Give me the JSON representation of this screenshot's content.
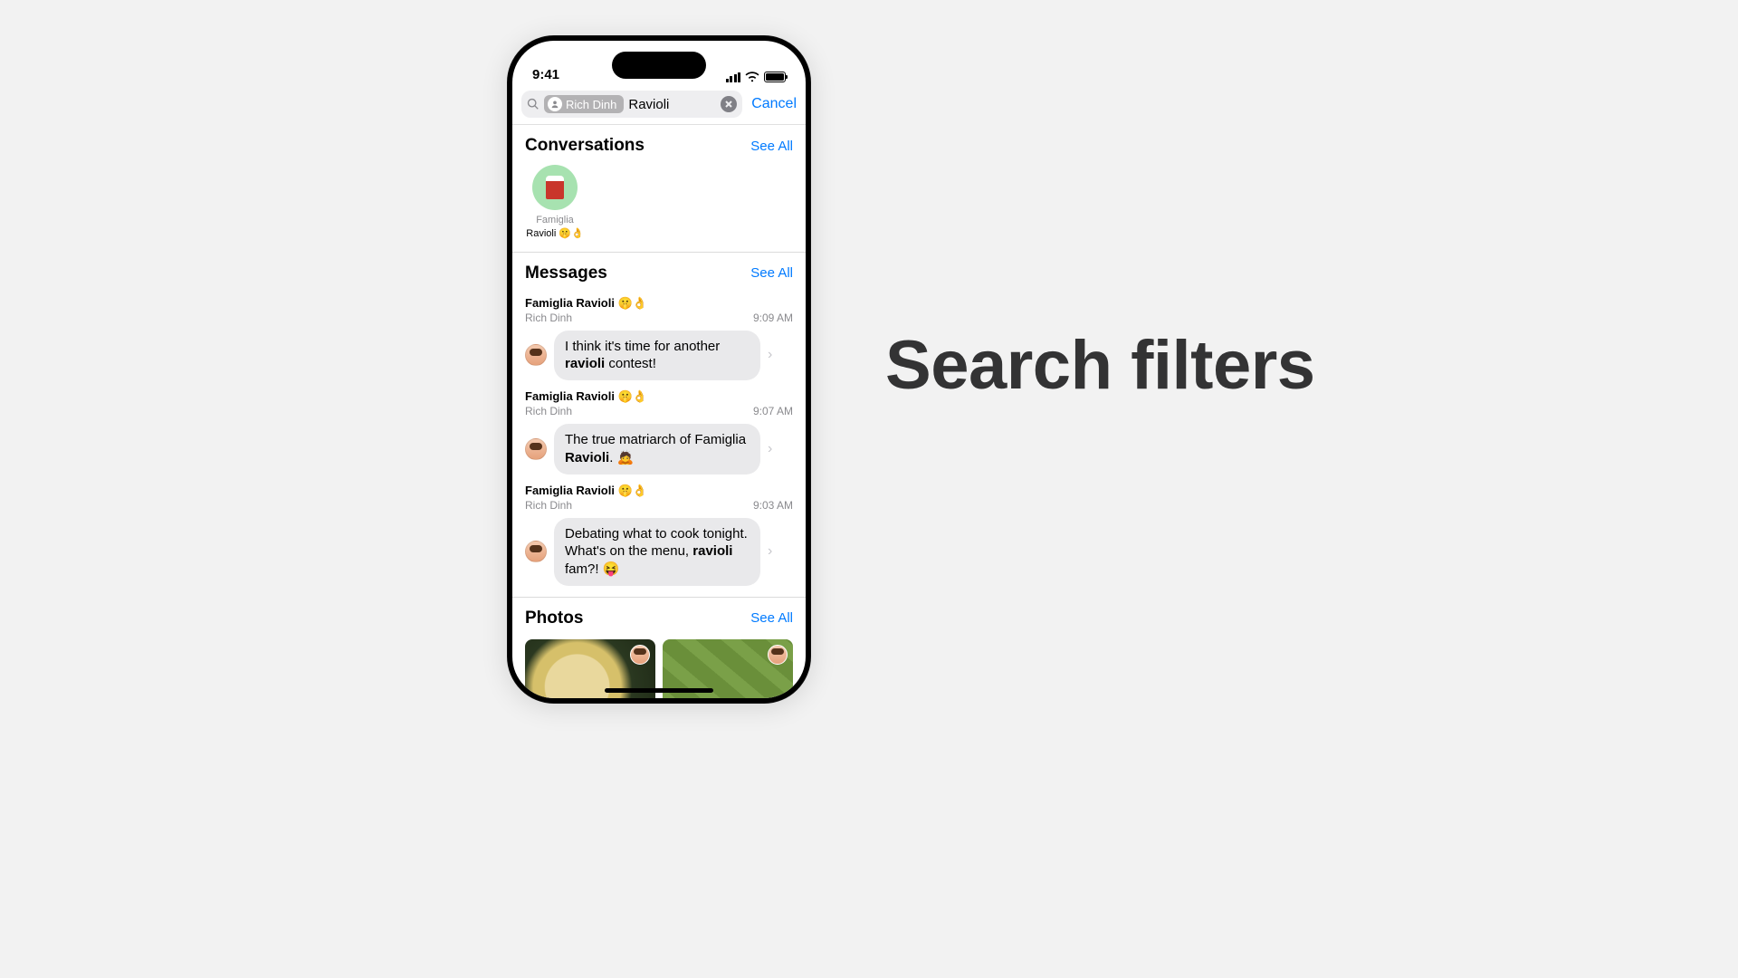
{
  "feature_title": "Search filters",
  "status": {
    "time": "9:41"
  },
  "search": {
    "token_name": "Rich Dinh",
    "query": "Ravioli",
    "cancel": "Cancel"
  },
  "sections": {
    "conversations": {
      "title": "Conversations",
      "see_all": "See All"
    },
    "messages": {
      "title": "Messages",
      "see_all": "See All"
    },
    "photos": {
      "title": "Photos",
      "see_all": "See All"
    }
  },
  "conversations": [
    {
      "label1": "Famiglia",
      "label2": "Ravioli 🤫👌"
    }
  ],
  "messages": [
    {
      "group": "Famiglia Ravioli 🤫👌",
      "sender": "Rich Dinh",
      "time": "9:09 AM",
      "text_pre": "I think it's time for another ",
      "keyword": "ravioli",
      "text_post": " contest!"
    },
    {
      "group": "Famiglia Ravioli 🤫👌",
      "sender": "Rich Dinh",
      "time": "9:07 AM",
      "text_pre": "The true matriarch of Famiglia ",
      "keyword": "Ravioli",
      "text_post": ". 🙇"
    },
    {
      "group": "Famiglia Ravioli 🤫👌",
      "sender": "Rich Dinh",
      "time": "9:03 AM",
      "text_pre": "Debating what to cook tonight. What's on the menu, ",
      "keyword": "ravioli",
      "text_post": " fam?! 😝"
    }
  ]
}
